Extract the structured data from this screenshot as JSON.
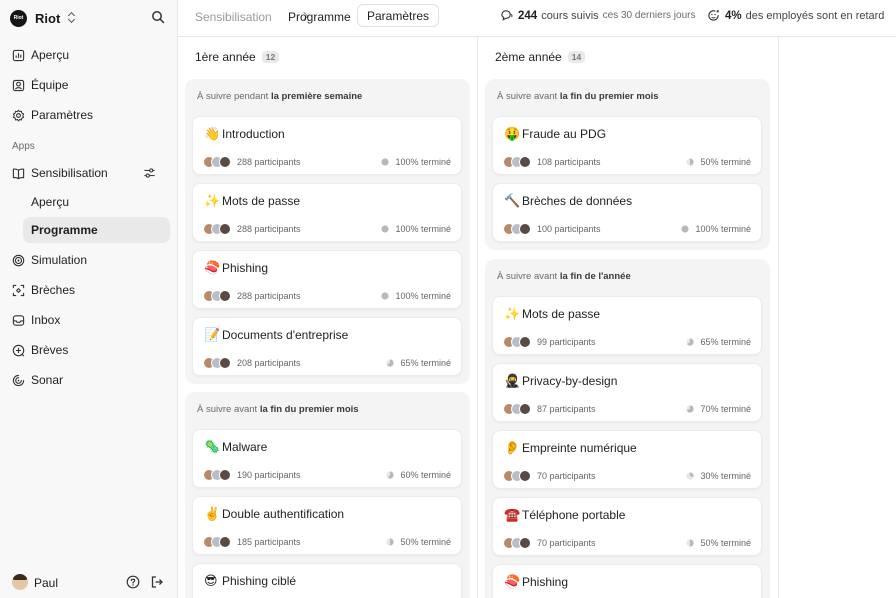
{
  "sidebar": {
    "brand": {
      "logo_text": "Riot",
      "name": "Riot"
    },
    "nav": [
      {
        "label": "Aperçu",
        "icon": "chart-icon"
      },
      {
        "label": "Équipe",
        "icon": "user-icon"
      },
      {
        "label": "Paramètres",
        "icon": "gear-icon"
      }
    ],
    "section_title": "Apps",
    "apps": [
      {
        "label": "Sensibilisation",
        "icon": "book-icon"
      },
      {
        "label": "Aperçu",
        "sub": true
      },
      {
        "label": "Programme",
        "sub": true,
        "active": true
      },
      {
        "label": "Simulation",
        "icon": "target-icon"
      },
      {
        "label": "Brèches",
        "icon": "breach-icon"
      },
      {
        "label": "Inbox",
        "icon": "inbox-icon"
      },
      {
        "label": "Brèves",
        "icon": "news-icon"
      },
      {
        "label": "Sonar",
        "icon": "sonar-icon"
      }
    ],
    "user": {
      "name": "Paul"
    }
  },
  "topbar": {
    "breadcrumb": [
      "Sensibilisation",
      "Programme"
    ],
    "tab": "Paramètres",
    "stats": [
      {
        "value": "244",
        "text": "cours suivis",
        "suffix": "ces 30 derniers jours",
        "icon": "chat-icon"
      },
      {
        "value": "4%",
        "text": "des employés sont en retard",
        "suffix": "",
        "icon": "late-icon"
      }
    ]
  },
  "colors": {
    "accent": "#1f1f1f",
    "muted": "#6a6a6a",
    "badge_bg": "#e9e9e9",
    "group_bg": "#f4f4f4",
    "pie": "#b8b8b8"
  },
  "columns": [
    {
      "title": "1ère année",
      "count": "12",
      "groups": [
        {
          "prefix": "À suivre pendant",
          "highlight": "la première semaine",
          "cards": [
            {
              "emoji": "👋",
              "title": "Introduction",
              "participants": "288 participants",
              "status": "100% terminé",
              "progress": 1.0
            },
            {
              "emoji": "✨",
              "title": "Mots de passe",
              "participants": "288 participants",
              "status": "100% terminé",
              "progress": 1.0
            },
            {
              "emoji": "🍣",
              "title": "Phishing",
              "participants": "288 participants",
              "status": "100% terminé",
              "progress": 1.0
            },
            {
              "emoji": "📝",
              "title": "Documents d'entreprise",
              "participants": "208 participants",
              "status": "65% terminé",
              "progress": 0.65
            }
          ]
        },
        {
          "prefix": "À suivre avant",
          "highlight": "la fin du premier mois",
          "cards": [
            {
              "emoji": "🦠",
              "title": "Malware",
              "participants": "190 participants",
              "status": "60% terminé",
              "progress": 0.6
            },
            {
              "emoji": "✌️",
              "title": "Double authentification",
              "participants": "185 participants",
              "status": "50% terminé",
              "progress": 0.5
            },
            {
              "emoji": "😎",
              "title": "Phishing ciblé",
              "participants": "",
              "status": "",
              "progress": 0
            }
          ]
        }
      ]
    },
    {
      "title": "2ème année",
      "count": "14",
      "groups": [
        {
          "prefix": "À suivre avant",
          "highlight": "la fin du premier mois",
          "cards": [
            {
              "emoji": "🤑",
              "title": "Fraude au PDG",
              "participants": "108 participants",
              "status": "50% terminé",
              "progress": 0.5
            },
            {
              "emoji": "🔨",
              "title": "Brèches de données",
              "participants": "100 participants",
              "status": "100% terminé",
              "progress": 1.0
            }
          ]
        },
        {
          "prefix": "À suivre avant",
          "highlight": "la fin de l'année",
          "cards": [
            {
              "emoji": "✨",
              "title": "Mots de passe",
              "participants": "99 participants",
              "status": "65% terminé",
              "progress": 0.65
            },
            {
              "emoji": "🥷",
              "title": "Privacy-by-design",
              "participants": "87 participants",
              "status": "70% terminé",
              "progress": 0.7
            },
            {
              "emoji": "👂",
              "title": "Empreinte numérique",
              "participants": "70 participants",
              "status": "30% terminé",
              "progress": 0.3
            },
            {
              "emoji": "☎️",
              "title": "Téléphone portable",
              "participants": "70 participants",
              "status": "50% terminé",
              "progress": 0.5
            },
            {
              "emoji": "🍣",
              "title": "Phishing",
              "participants": "",
              "status": "",
              "progress": 0
            }
          ]
        }
      ]
    }
  ]
}
